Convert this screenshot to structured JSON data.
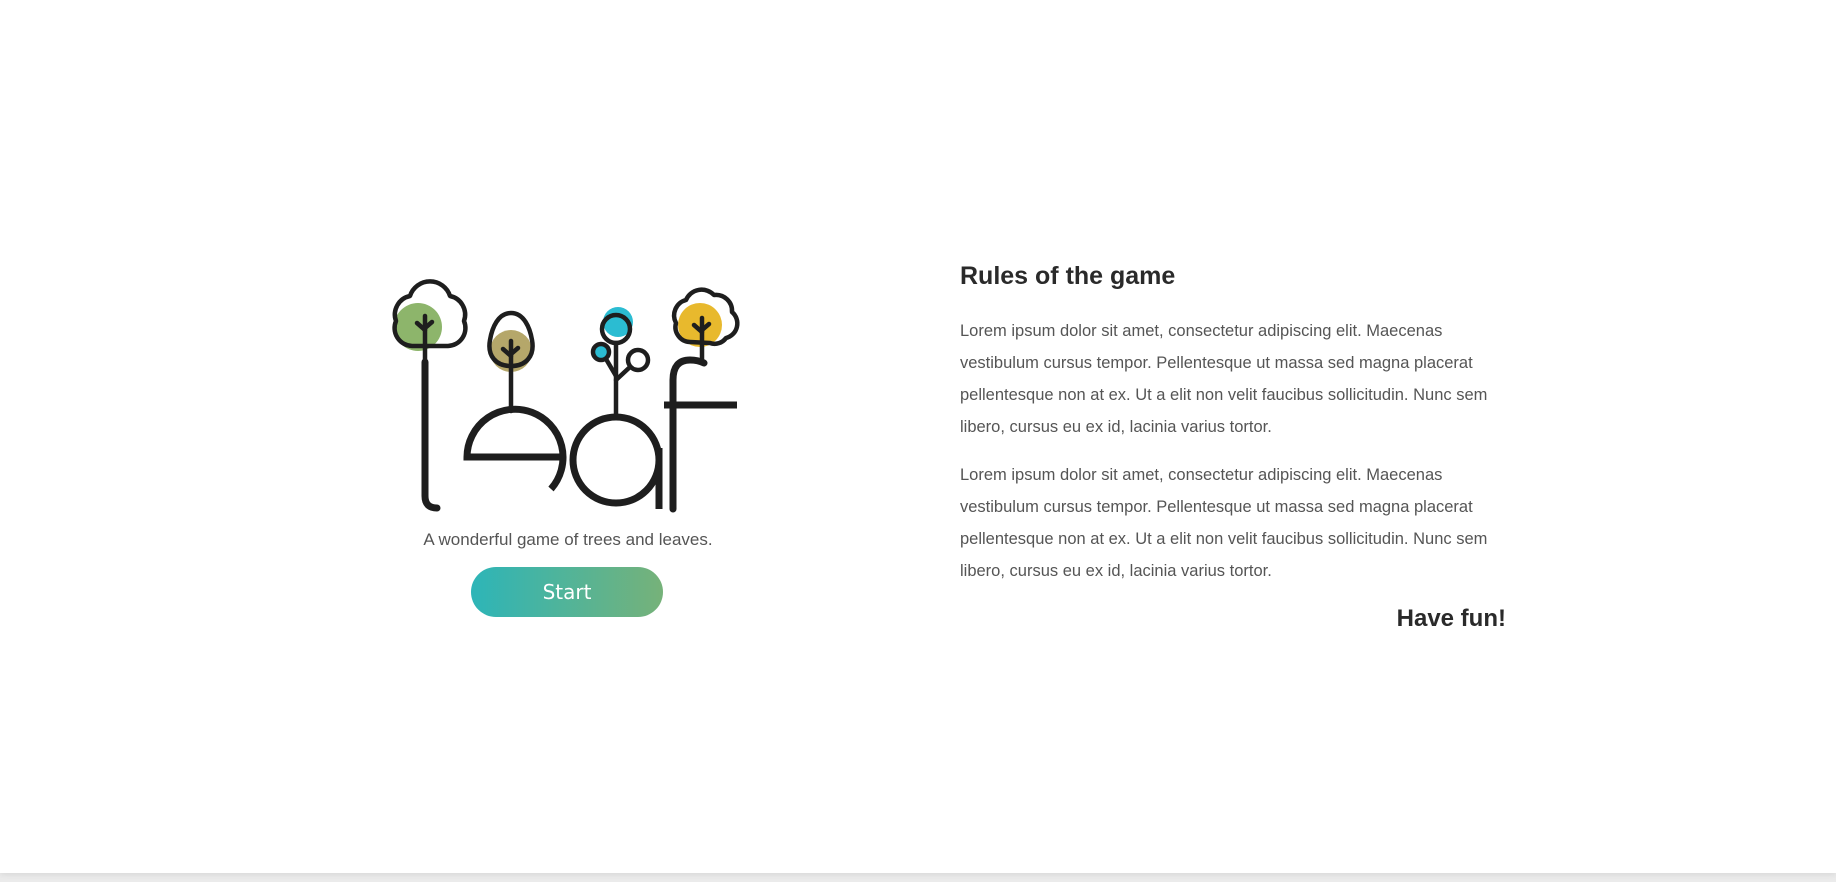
{
  "hero": {
    "logo_text": "leaf",
    "tagline": "A wonderful game of trees and leaves.",
    "start_label": "Start"
  },
  "rules": {
    "title": "Rules of the game",
    "paragraphs": [
      "Lorem ipsum dolor sit amet, consectetur adipiscing elit. Maecenas vestibulum cursus tempor. Pellentesque ut massa sed magna placerat pellentesque non at ex. Ut a elit non velit faucibus sollicitudin. Nunc sem libero, cursus eu ex id, lacinia varius tortor.",
      "Lorem ipsum dolor sit amet, consectetur adipiscing elit. Maecenas vestibulum cursus tempor. Pellentesque ut massa sed magna placerat pellentesque non at ex. Ut a elit non velit faucibus sollicitudin. Nunc sem libero, cursus eu ex id, lacinia varius tortor."
    ],
    "closing": "Have fun!"
  },
  "colors": {
    "leaf_green": "#8db56b",
    "leaf_olive": "#b5a76a",
    "leaf_cyan": "#2bbcd2",
    "leaf_yellow": "#e8b92d",
    "button_gradient_start": "#2db5b8",
    "button_gradient_end": "#76b279",
    "ink": "#1e1e1e"
  },
  "icons": [
    "tree-green-icon",
    "tree-olive-icon",
    "tree-cyan-icon",
    "tree-yellow-icon"
  ]
}
